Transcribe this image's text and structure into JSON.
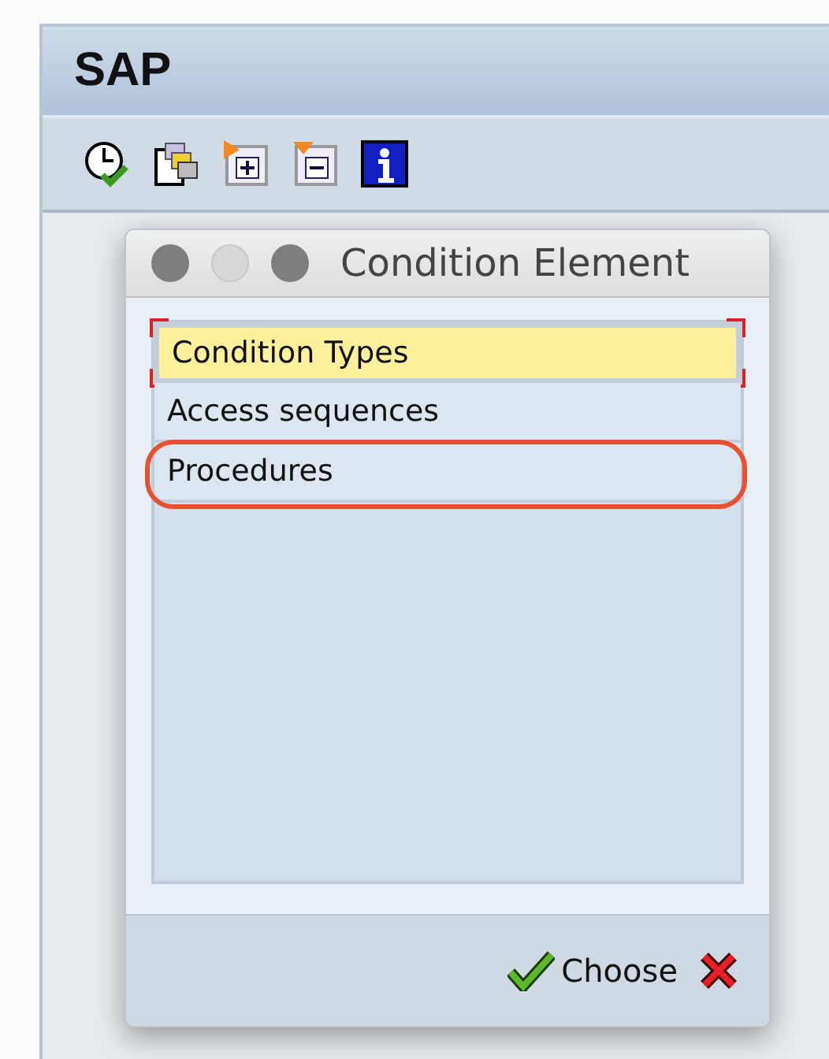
{
  "window": {
    "title": "SAP"
  },
  "toolbar": [
    {
      "kind": "clock"
    },
    {
      "kind": "copy"
    },
    {
      "kind": "expand"
    },
    {
      "kind": "collapse"
    },
    {
      "kind": "info"
    }
  ],
  "dialog": {
    "title": "Condition Element",
    "window_buttons": [
      {
        "disabled": false
      },
      {
        "disabled": true
      },
      {
        "disabled": false
      }
    ],
    "items": [
      {
        "label": "Condition Types",
        "selected": true,
        "circled": false
      },
      {
        "label": "Access sequences",
        "selected": false,
        "circled": false
      },
      {
        "label": "Procedures",
        "selected": false,
        "circled": true
      }
    ],
    "buttons": [
      {
        "kind": "choose",
        "label": "Choose"
      },
      {
        "kind": "cancel"
      }
    ]
  }
}
